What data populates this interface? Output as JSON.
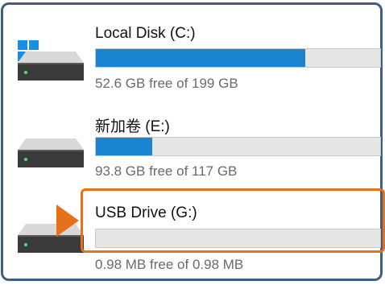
{
  "colors": {
    "frame_border": "#3f5f7f",
    "bar_fill": "#1a84d1",
    "bar_track": "#e6e6e6",
    "highlight": "#e8701a",
    "windows_logo": "#1a8fe0"
  },
  "drives": [
    {
      "name": "Local Disk (C:)",
      "free_text": "52.6 GB free of 199 GB",
      "used_fraction": 0.736,
      "icon": "hard-drive-icon",
      "system_drive_icon": "windows-logo-icon"
    },
    {
      "name": "新加卷 (E:)",
      "free_text": "93.8 GB free of 117 GB",
      "used_fraction": 0.198,
      "icon": "hard-drive-icon"
    },
    {
      "name": "USB Drive (G:)",
      "free_text": "0.98 MB free of 0.98 MB",
      "used_fraction": 0,
      "icon": "hard-drive-icon",
      "highlighted": true
    }
  ],
  "annotation": {
    "arrow_icon": "pointer-arrow-icon",
    "highlight_box": "orange-highlight-box"
  }
}
